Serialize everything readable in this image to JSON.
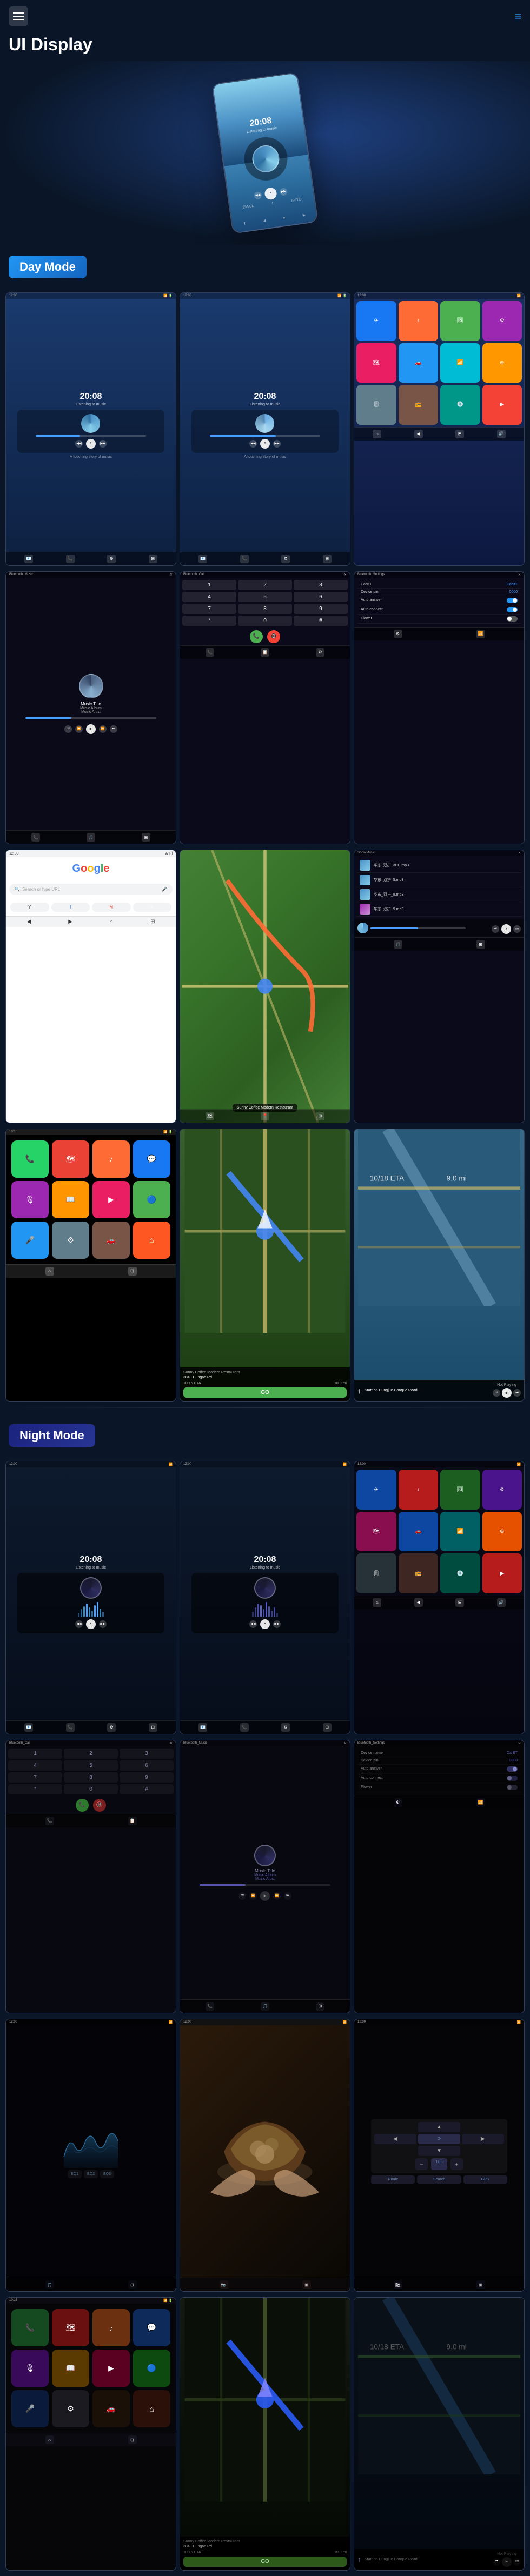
{
  "header": {
    "title": "UI Display",
    "menu_icon": "☰",
    "lines_icon": "≡"
  },
  "sections": {
    "day_mode": "Day Mode",
    "night_mode": "Night Mode"
  },
  "screenshots": {
    "home1": {
      "time": "20:08",
      "sub": "Listening to music"
    },
    "home2": {
      "time": "20:08",
      "sub": "Listening to music"
    },
    "music": {
      "title": "Music Title",
      "album": "Music Album",
      "artist": "Music Artist"
    },
    "bluetooth_music": "Bluetooth_Music",
    "bluetooth_call": "Bluetooth_Call",
    "bluetooth_settings": "Bluetooth_Settings",
    "device_name": "CarBT",
    "device_pin": "0000",
    "auto_answer": "Auto answer",
    "auto_connect": "Auto connect",
    "flower": "Flower",
    "social_music": "SocialMusic",
    "google": "Google",
    "nav_place": "Sunny Coffee Modern Restaurant",
    "nav_address": "3849 Dungan Rd",
    "nav_distance": "10.9 mi",
    "nav_time": "9.0 mi",
    "eta": "10:16 ETA",
    "go_btn": "GO",
    "start_on": "Start on Dungjue Donque Road",
    "not_playing": "Not Playing",
    "music_files": [
      "华东_双拼_3DE.mp3",
      "华东_双拼_5.mp3",
      "华东_双拼_8.mp3"
    ]
  },
  "colors": {
    "accent_blue": "#2196f3",
    "day_badge": "#1565c0",
    "night_badge": "#283593",
    "bg_dark": "#0a1628",
    "screen_bg": "#1a2a4a"
  }
}
